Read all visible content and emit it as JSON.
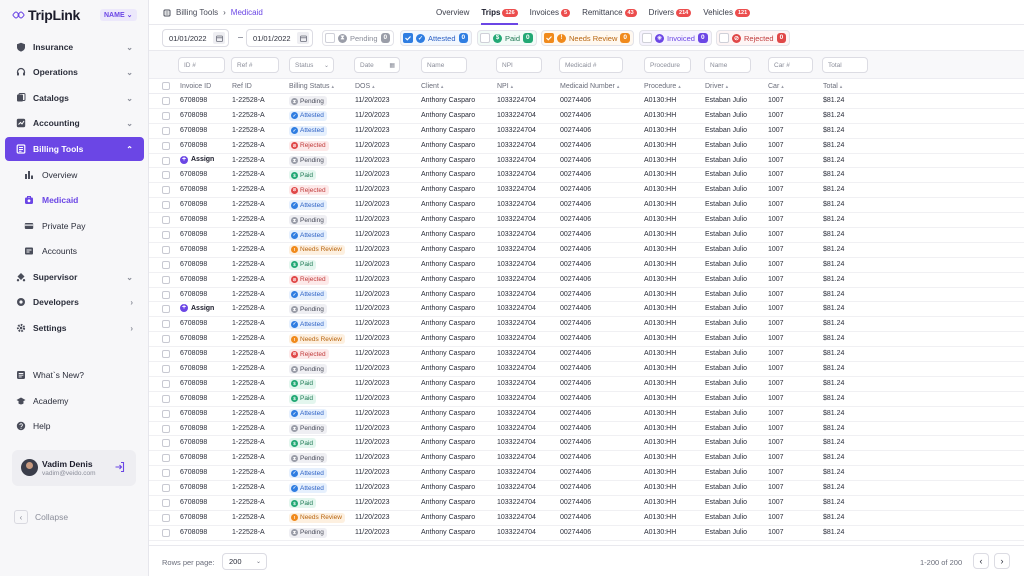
{
  "brand": {
    "name": "TripLink",
    "badge": "NAME"
  },
  "sidebar": {
    "items": [
      {
        "label": "Insurance",
        "icon": "shield-icon"
      },
      {
        "label": "Operations",
        "icon": "headset-icon"
      },
      {
        "label": "Catalogs",
        "icon": "catalog-icon"
      },
      {
        "label": "Accounting",
        "icon": "chart-icon"
      },
      {
        "label": "Billing Tools",
        "icon": "billing-icon"
      },
      {
        "label": "Supervisor",
        "icon": "supervisor-icon"
      },
      {
        "label": "Developers",
        "icon": "developers-icon"
      },
      {
        "label": "Settings",
        "icon": "gear-icon"
      }
    ],
    "sub_items": [
      {
        "label": "Overview",
        "icon": "bar-chart-icon"
      },
      {
        "label": "Medicaid",
        "icon": "medicaid-icon"
      },
      {
        "label": "Private Pay",
        "icon": "card-icon"
      },
      {
        "label": "Accounts",
        "icon": "accounts-icon"
      }
    ],
    "extras": [
      {
        "label": "What`s New?",
        "icon": "news-icon"
      },
      {
        "label": "Academy",
        "icon": "academy-icon"
      },
      {
        "label": "Help",
        "icon": "help-icon"
      }
    ],
    "user": {
      "name": "Vadim Denis",
      "email": "vadim@veido.com"
    },
    "collapse_label": "Collapse"
  },
  "breadcrumb": {
    "parent": "Billing Tools",
    "current": "Medicaid"
  },
  "tabs": [
    {
      "label": "Overview",
      "badge": ""
    },
    {
      "label": "Trips",
      "badge": "126"
    },
    {
      "label": "Invoices",
      "badge": "5"
    },
    {
      "label": "Remittance",
      "badge": "43"
    },
    {
      "label": "Drivers",
      "badge": "214"
    },
    {
      "label": "Vehicles",
      "badge": "121"
    }
  ],
  "filters": {
    "date_from": "01/01/2022",
    "date_to": "01/01/2022",
    "chips": [
      {
        "label": "Pending",
        "count": "0"
      },
      {
        "label": "Attested",
        "count": "0"
      },
      {
        "label": "Paid",
        "count": "0"
      },
      {
        "label": "Needs Review",
        "count": "0"
      },
      {
        "label": "Invoiced",
        "count": "0"
      },
      {
        "label": "Rejected",
        "count": "0"
      }
    ],
    "placeholders": [
      "ID #",
      "Ref #",
      "Status",
      "Date",
      "Name",
      "NPI",
      "Medicaid #",
      "Procedure",
      "Name",
      "Car #",
      "Total"
    ]
  },
  "table": {
    "columns": [
      "Invoice ID",
      "Ref ID",
      "Billing Status",
      "DOS",
      "Client",
      "NPI",
      "Medicaid Number",
      "Procedure",
      "Driver",
      "Car",
      "Total"
    ],
    "assign_label": "Assign",
    "row_template": {
      "invoice_id": "6708098",
      "ref_id": "1-22528-A",
      "dos": "11/20/2023",
      "client": "Anthony Casparo",
      "npi": "1033224704",
      "medicaid": "00274406",
      "procedure": "A0130:HH",
      "driver": "Estaban Julio",
      "car": "1007",
      "total": "$81.24"
    },
    "rows": [
      {
        "status": "Pending",
        "assign": false
      },
      {
        "status": "Attested",
        "assign": false
      },
      {
        "status": "Attested",
        "assign": false
      },
      {
        "status": "Rejected",
        "assign": false
      },
      {
        "status": "Pending",
        "assign": true
      },
      {
        "status": "Paid",
        "assign": false
      },
      {
        "status": "Rejected",
        "assign": false
      },
      {
        "status": "Attested",
        "assign": false
      },
      {
        "status": "Pending",
        "assign": false
      },
      {
        "status": "Attested",
        "assign": false
      },
      {
        "status": "Needs Review",
        "assign": false
      },
      {
        "status": "Paid",
        "assign": false
      },
      {
        "status": "Rejected",
        "assign": false
      },
      {
        "status": "Attested",
        "assign": false
      },
      {
        "status": "Pending",
        "assign": true
      },
      {
        "status": "Attested",
        "assign": false
      },
      {
        "status": "Needs Review",
        "assign": false
      },
      {
        "status": "Rejected",
        "assign": false
      },
      {
        "status": "Pending",
        "assign": false
      },
      {
        "status": "Paid",
        "assign": false
      },
      {
        "status": "Paid",
        "assign": false
      },
      {
        "status": "Attested",
        "assign": false
      },
      {
        "status": "Pending",
        "assign": false
      },
      {
        "status": "Paid",
        "assign": false
      },
      {
        "status": "Pending",
        "assign": false
      },
      {
        "status": "Attested",
        "assign": false
      },
      {
        "status": "Attested",
        "assign": false
      },
      {
        "status": "Paid",
        "assign": false
      },
      {
        "status": "Needs Review",
        "assign": false
      },
      {
        "status": "Pending",
        "assign": false
      }
    ]
  },
  "status_styles": {
    "Pending": {
      "bg": "#efeff3",
      "fg": "#4a4d5a",
      "dot": "#9a9da8",
      "glyph": "⧗"
    },
    "Attested": {
      "bg": "#e6f0fd",
      "fg": "#2a5fc4",
      "dot": "#2f7de1",
      "glyph": "✓"
    },
    "Paid": {
      "bg": "#e3f6ee",
      "fg": "#1f7a55",
      "dot": "#22a874",
      "glyph": "$"
    },
    "Rejected": {
      "bg": "#fde9e9",
      "fg": "#c03b3b",
      "dot": "#e04848",
      "glyph": "⊘"
    },
    "Needs Review": {
      "bg": "#fdf0e0",
      "fg": "#b8650f",
      "dot": "#f08a1c",
      "glyph": "!"
    },
    "Invoiced": {
      "bg": "#ece8fb",
      "fg": "#6b46e5",
      "dot": "#6b46e5",
      "glyph": "✳"
    }
  },
  "pagination": {
    "rows_per_page_label": "Rows per page:",
    "rows_per_page": "200",
    "range": "1-200 of 200"
  }
}
